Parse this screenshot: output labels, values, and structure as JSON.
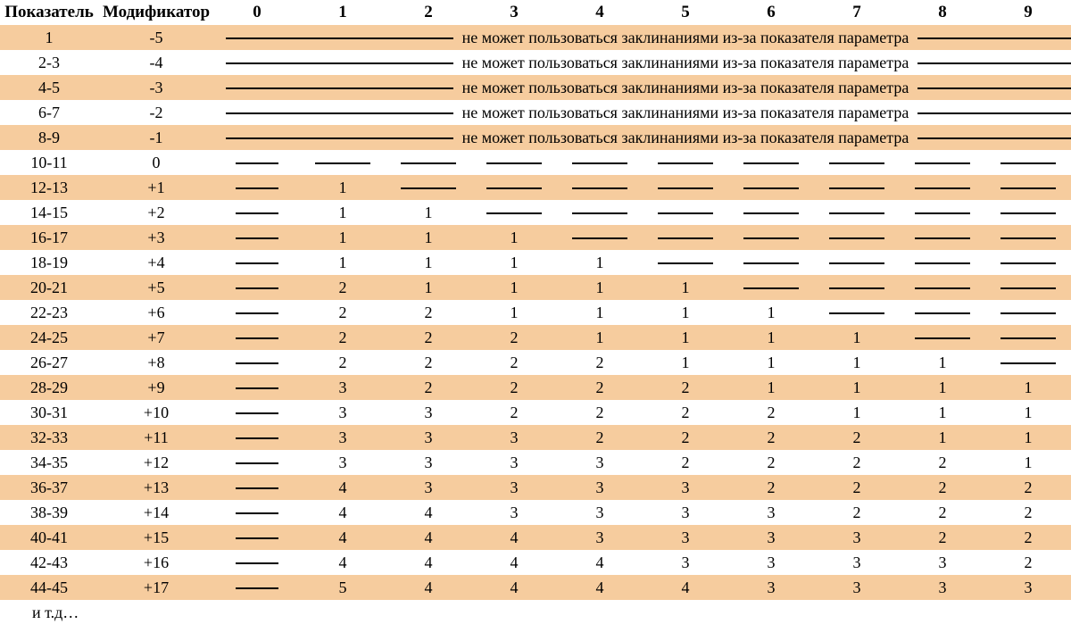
{
  "headers": {
    "score": "Показатель",
    "modifier": "Модификатор",
    "spell_levels": [
      "0",
      "1",
      "2",
      "3",
      "4",
      "5",
      "6",
      "7",
      "8",
      "9"
    ]
  },
  "cannot_cast_rows": [
    {
      "score": "1",
      "modifier": "-5"
    },
    {
      "score": "2-3",
      "modifier": "-4"
    },
    {
      "score": "4-5",
      "modifier": "-3"
    },
    {
      "score": "6-7",
      "modifier": "-2"
    },
    {
      "score": "8-9",
      "modifier": "-1"
    }
  ],
  "cannot_cast_text": "не   может пользоваться заклинаниями из-за показателя параметра",
  "bonus_rows": [
    {
      "score": "10-11",
      "modifier": "0",
      "spells": [
        null,
        null,
        null,
        null,
        null,
        null,
        null,
        null,
        null,
        null
      ]
    },
    {
      "score": "12-13",
      "modifier": "+1",
      "spells": [
        null,
        "1",
        null,
        null,
        null,
        null,
        null,
        null,
        null,
        null
      ]
    },
    {
      "score": "14-15",
      "modifier": "+2",
      "spells": [
        null,
        "1",
        "1",
        null,
        null,
        null,
        null,
        null,
        null,
        null
      ]
    },
    {
      "score": "16-17",
      "modifier": "+3",
      "spells": [
        null,
        "1",
        "1",
        "1",
        null,
        null,
        null,
        null,
        null,
        null
      ]
    },
    {
      "score": "18-19",
      "modifier": "+4",
      "spells": [
        null,
        "1",
        "1",
        "1",
        "1",
        null,
        null,
        null,
        null,
        null
      ]
    },
    {
      "score": "20-21",
      "modifier": "+5",
      "spells": [
        null,
        "2",
        "1",
        "1",
        "1",
        "1",
        null,
        null,
        null,
        null
      ]
    },
    {
      "score": "22-23",
      "modifier": "+6",
      "spells": [
        null,
        "2",
        "2",
        "1",
        "1",
        "1",
        "1",
        null,
        null,
        null
      ]
    },
    {
      "score": "24-25",
      "modifier": "+7",
      "spells": [
        null,
        "2",
        "2",
        "2",
        "1",
        "1",
        "1",
        "1",
        null,
        null
      ]
    },
    {
      "score": "26-27",
      "modifier": "+8",
      "spells": [
        null,
        "2",
        "2",
        "2",
        "2",
        "1",
        "1",
        "1",
        "1",
        null
      ]
    },
    {
      "score": "28-29",
      "modifier": "+9",
      "spells": [
        null,
        "3",
        "2",
        "2",
        "2",
        "2",
        "1",
        "1",
        "1",
        "1"
      ]
    },
    {
      "score": "30-31",
      "modifier": "+10",
      "spells": [
        null,
        "3",
        "3",
        "2",
        "2",
        "2",
        "2",
        "1",
        "1",
        "1"
      ]
    },
    {
      "score": "32-33",
      "modifier": "+11",
      "spells": [
        null,
        "3",
        "3",
        "3",
        "2",
        "2",
        "2",
        "2",
        "1",
        "1"
      ]
    },
    {
      "score": "34-35",
      "modifier": "+12",
      "spells": [
        null,
        "3",
        "3",
        "3",
        "3",
        "2",
        "2",
        "2",
        "2",
        "1"
      ]
    },
    {
      "score": "36-37",
      "modifier": "+13",
      "spells": [
        null,
        "4",
        "3",
        "3",
        "3",
        "3",
        "2",
        "2",
        "2",
        "2"
      ]
    },
    {
      "score": "38-39",
      "modifier": "+14",
      "spells": [
        null,
        "4",
        "4",
        "3",
        "3",
        "3",
        "3",
        "2",
        "2",
        "2"
      ]
    },
    {
      "score": "40-41",
      "modifier": "+15",
      "spells": [
        null,
        "4",
        "4",
        "4",
        "3",
        "3",
        "3",
        "3",
        "2",
        "2"
      ]
    },
    {
      "score": "42-43",
      "modifier": "+16",
      "spells": [
        null,
        "4",
        "4",
        "4",
        "4",
        "3",
        "3",
        "3",
        "3",
        "2"
      ]
    },
    {
      "score": "44-45",
      "modifier": "+17",
      "spells": [
        null,
        "5",
        "4",
        "4",
        "4",
        "4",
        "3",
        "3",
        "3",
        "3"
      ]
    }
  ],
  "footer": "и т.д…",
  "chart_data": {
    "type": "table",
    "title": "Ability score modifiers and bonus spells per day",
    "columns": [
      "Показатель",
      "Модификатор",
      "0",
      "1",
      "2",
      "3",
      "4",
      "5",
      "6",
      "7",
      "8",
      "9"
    ],
    "rows": [
      [
        "1",
        "-5",
        "cannot cast"
      ],
      [
        "2-3",
        "-4",
        "cannot cast"
      ],
      [
        "4-5",
        "-3",
        "cannot cast"
      ],
      [
        "6-7",
        "-2",
        "cannot cast"
      ],
      [
        "8-9",
        "-1",
        "cannot cast"
      ],
      [
        "10-11",
        "0",
        "—",
        "—",
        "—",
        "—",
        "—",
        "—",
        "—",
        "—",
        "—",
        "—"
      ],
      [
        "12-13",
        "+1",
        "—",
        "1",
        "—",
        "—",
        "—",
        "—",
        "—",
        "—",
        "—",
        "—"
      ],
      [
        "14-15",
        "+2",
        "—",
        "1",
        "1",
        "—",
        "—",
        "—",
        "—",
        "—",
        "—",
        "—"
      ],
      [
        "16-17",
        "+3",
        "—",
        "1",
        "1",
        "1",
        "—",
        "—",
        "—",
        "—",
        "—",
        "—"
      ],
      [
        "18-19",
        "+4",
        "—",
        "1",
        "1",
        "1",
        "1",
        "—",
        "—",
        "—",
        "—",
        "—"
      ],
      [
        "20-21",
        "+5",
        "—",
        "2",
        "1",
        "1",
        "1",
        "1",
        "—",
        "—",
        "—",
        "—"
      ],
      [
        "22-23",
        "+6",
        "—",
        "2",
        "2",
        "1",
        "1",
        "1",
        "1",
        "—",
        "—",
        "—"
      ],
      [
        "24-25",
        "+7",
        "—",
        "2",
        "2",
        "2",
        "1",
        "1",
        "1",
        "1",
        "—",
        "—"
      ],
      [
        "26-27",
        "+8",
        "—",
        "2",
        "2",
        "2",
        "2",
        "1",
        "1",
        "1",
        "1",
        "—"
      ],
      [
        "28-29",
        "+9",
        "—",
        "3",
        "2",
        "2",
        "2",
        "2",
        "1",
        "1",
        "1",
        "1"
      ],
      [
        "30-31",
        "+10",
        "—",
        "3",
        "3",
        "2",
        "2",
        "2",
        "2",
        "1",
        "1",
        "1"
      ],
      [
        "32-33",
        "+11",
        "—",
        "3",
        "3",
        "3",
        "2",
        "2",
        "2",
        "2",
        "1",
        "1"
      ],
      [
        "34-35",
        "+12",
        "—",
        "3",
        "3",
        "3",
        "3",
        "2",
        "2",
        "2",
        "2",
        "1"
      ],
      [
        "36-37",
        "+13",
        "—",
        "4",
        "3",
        "3",
        "3",
        "3",
        "2",
        "2",
        "2",
        "2"
      ],
      [
        "38-39",
        "+14",
        "—",
        "4",
        "4",
        "3",
        "3",
        "3",
        "3",
        "2",
        "2",
        "2"
      ],
      [
        "40-41",
        "+15",
        "—",
        "4",
        "4",
        "4",
        "3",
        "3",
        "3",
        "3",
        "2",
        "2"
      ],
      [
        "42-43",
        "+16",
        "—",
        "4",
        "4",
        "4",
        "4",
        "3",
        "3",
        "3",
        "3",
        "2"
      ],
      [
        "44-45",
        "+17",
        "—",
        "5",
        "4",
        "4",
        "4",
        "4",
        "3",
        "3",
        "3",
        "3"
      ]
    ],
    "cannot_cast_note": "не может пользоваться заклинаниями из-за показателя параметра"
  }
}
